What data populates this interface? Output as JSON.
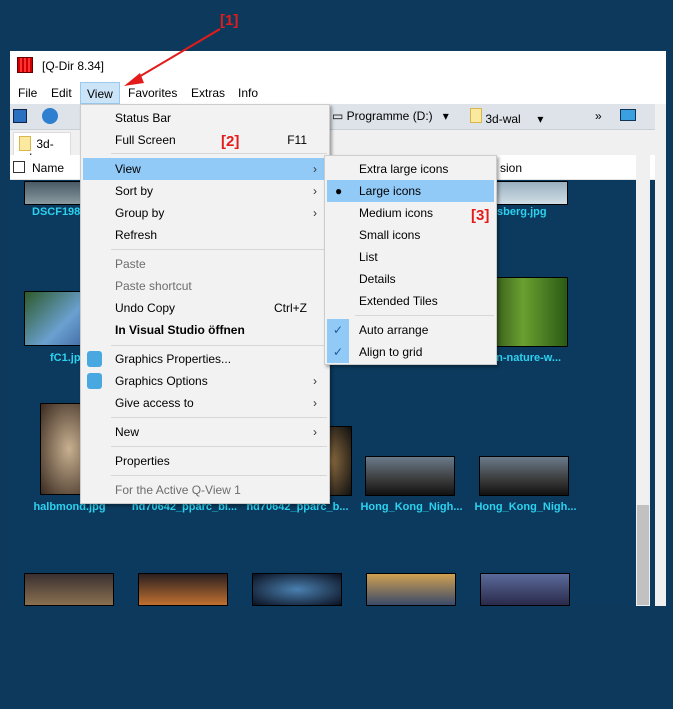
{
  "annotations": [
    "[1]",
    "[2]",
    "[3]"
  ],
  "window": {
    "title": "[Q-Dir 8.34]"
  },
  "menubar": [
    "File",
    "Edit",
    "View",
    "Favorites",
    "Extras",
    "Info"
  ],
  "toolbar": {
    "drive": "Programme (D:)",
    "folder": "3d-wal"
  },
  "tab": {
    "label": "3d-wal"
  },
  "header": {
    "name": "Name",
    "extension": "sion"
  },
  "files": [
    "DSCF198",
    "isberg.jpg",
    "fC1.jp",
    "en-nature-w...",
    "halbmond.jpg",
    "hd70642_pparc_bi...",
    "hd70642_pparc_b...",
    "Hong_Kong_Nigh...",
    "Hong_Kong_Nigh..."
  ],
  "menu": {
    "status_bar": "Status Bar",
    "full_screen": "Full Screen",
    "full_screen_key": "F11",
    "view": "View",
    "sort_by": "Sort by",
    "group_by": "Group by",
    "refresh": "Refresh",
    "paste": "Paste",
    "paste_shortcut": "Paste shortcut",
    "undo_copy": "Undo Copy",
    "undo_key": "Ctrl+Z",
    "visual_studio": "In Visual Studio öffnen",
    "graphics_properties": "Graphics Properties...",
    "graphics_options": "Graphics Options",
    "give_access": "Give access to",
    "new": "New",
    "properties": "Properties",
    "active_qview": "For the Active Q-View 1"
  },
  "submenu": {
    "extra_large": "Extra large icons",
    "large": "Large icons",
    "medium": "Medium icons",
    "small": "Small icons",
    "list": "List",
    "details": "Details",
    "extended_tiles": "Extended Tiles",
    "auto_arrange": "Auto arrange",
    "align_grid": "Align to grid",
    "selected": "Large icons"
  },
  "colors": {
    "highlight": "#91c9f7",
    "label": "#2cd2f0",
    "annotation": "#e41b1b",
    "background": "#0d3a5c"
  }
}
